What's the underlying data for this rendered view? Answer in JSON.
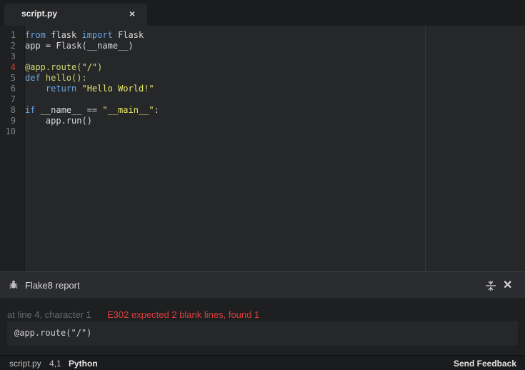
{
  "tab": {
    "label": "script.py",
    "close": "×"
  },
  "editor": {
    "line_numbers": [
      "1",
      "2",
      "3",
      "4",
      "5",
      "6",
      "7",
      "8",
      "9",
      "10"
    ],
    "error_line": "4",
    "lines": [
      {
        "tokens": [
          {
            "t": "from",
            "c": "kw"
          },
          {
            "t": " flask ",
            "c": "name"
          },
          {
            "t": "import",
            "c": "kw"
          },
          {
            "t": " Flask",
            "c": "name"
          }
        ]
      },
      {
        "tokens": [
          {
            "t": "app = Flask(__name__)",
            "c": "name"
          }
        ]
      },
      {
        "tokens": []
      },
      {
        "tokens": [
          {
            "t": "@app.route(",
            "c": "dec"
          },
          {
            "t": "\"/\"",
            "c": "str"
          },
          {
            "t": ")",
            "c": "dec"
          }
        ]
      },
      {
        "tokens": [
          {
            "t": "def",
            "c": "kw"
          },
          {
            "t": " hello():",
            "c": "fn"
          }
        ]
      },
      {
        "tokens": [
          {
            "t": "    ",
            "c": "name"
          },
          {
            "t": "return",
            "c": "kw"
          },
          {
            "t": " ",
            "c": "name"
          },
          {
            "t": "\"Hello World!\"",
            "c": "str"
          }
        ]
      },
      {
        "tokens": []
      },
      {
        "tokens": [
          {
            "t": "if",
            "c": "kw"
          },
          {
            "t": " __name__ == ",
            "c": "name"
          },
          {
            "t": "\"__main__\"",
            "c": "str"
          },
          {
            "t": ":",
            "c": "name"
          }
        ]
      },
      {
        "tokens": [
          {
            "t": "    app.run()",
            "c": "name"
          }
        ]
      },
      {
        "tokens": []
      }
    ]
  },
  "panel": {
    "title": "Flake8 report",
    "location": "at line 4, character 1",
    "error": "E302 expected 2 blank lines, found 1",
    "snippet": "@app.route(\"/\")",
    "close": "✕"
  },
  "statusbar": {
    "file": "script.py",
    "position": "4,1",
    "language": "Python",
    "feedback": "Send Feedback"
  },
  "colors": {
    "keyword": "#6aa6e3",
    "string": "#e8e86a",
    "decorator": "#c9d872",
    "error": "#d83c3c"
  }
}
